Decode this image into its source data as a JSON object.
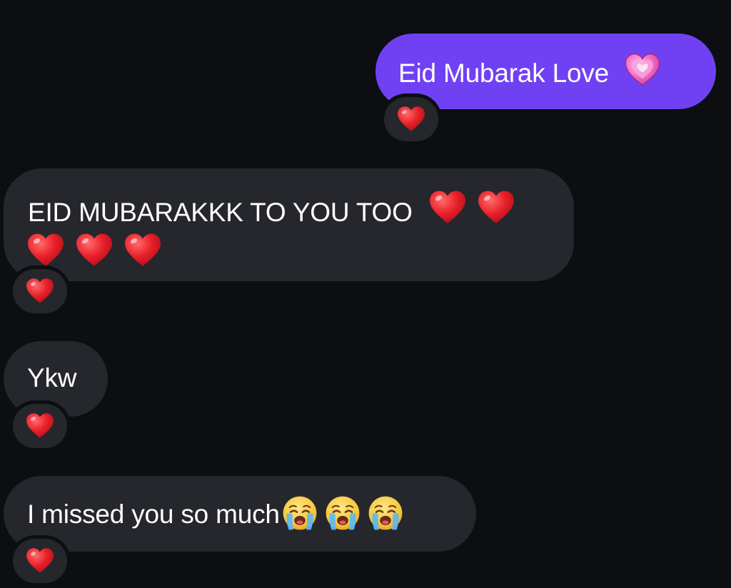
{
  "colors": {
    "background": "#0c0e12",
    "outgoing_bubble": "#7041f3",
    "incoming_bubble": "#25272c",
    "text": "#ffffff",
    "heart_red": "#e8202a"
  },
  "messages": [
    {
      "direction": "outgoing",
      "text": "Eid Mubarak Love",
      "emoji_icons": [
        "sparkling-pink-heart-icon"
      ],
      "reaction_icon": "red-heart-icon"
    },
    {
      "direction": "incoming",
      "text": "EID MUBARAKKK TO YOU TOO",
      "emoji_icons": [
        "red-heart-icon",
        "red-heart-icon",
        "red-heart-icon",
        "red-heart-icon",
        "red-heart-icon"
      ],
      "reaction_icon": "red-heart-icon"
    },
    {
      "direction": "incoming",
      "text": "Ykw",
      "emoji_icons": [],
      "reaction_icon": "red-heart-icon"
    },
    {
      "direction": "incoming",
      "text": "I missed you so much",
      "emoji_icons": [
        "loudly-crying-face-icon",
        "loudly-crying-face-icon",
        "loudly-crying-face-icon"
      ],
      "reaction_icon": "red-heart-icon"
    }
  ]
}
